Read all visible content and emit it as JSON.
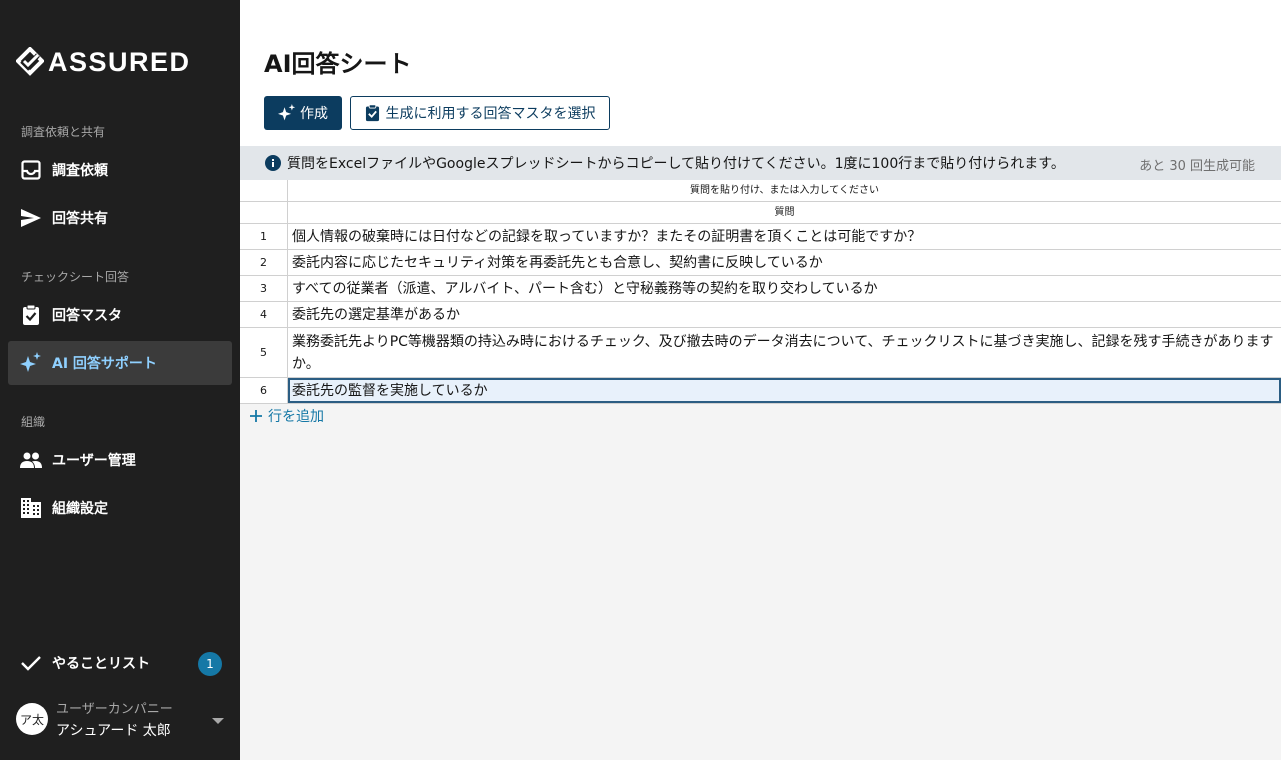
{
  "brand": {
    "name": "ASSURED"
  },
  "sidebar": {
    "sections": [
      {
        "label": "調査依頼と共有"
      },
      {
        "label": "チェックシート回答"
      },
      {
        "label": "組織"
      }
    ],
    "items": [
      {
        "label": "調査依頼",
        "icon": "inbox-icon"
      },
      {
        "label": "回答共有",
        "icon": "send-icon"
      },
      {
        "label": "回答マスタ",
        "icon": "clipboard-check-icon"
      },
      {
        "label": "AI 回答サポート",
        "icon": "sparkle-icon",
        "active": true
      },
      {
        "label": "ユーザー管理",
        "icon": "people-icon"
      },
      {
        "label": "組織設定",
        "icon": "building-icon"
      }
    ],
    "todo": {
      "label": "やることリスト",
      "count": "1"
    },
    "user": {
      "avatar": "ア太",
      "company": "ユーザーカンパニー",
      "name": "アシュアード 太郎"
    }
  },
  "main": {
    "title": "AI回答シート",
    "create_button": "作成",
    "select_master_button": "生成に利用する回答マスタを選択",
    "info": "質問をExcelファイルやGoogleスプレッドシートからコピーして貼り付けてください。1度に100行まで貼り付けられます。",
    "remaining": "あと 30 回生成可能",
    "table": {
      "instruction_header": "質問を貼り付け、または入力してください",
      "column_header": "質問",
      "rows": [
        {
          "num": "1",
          "text": "個人情報の破棄時には日付などの記録を取っていますか？またその証明書を頂くことは可能ですか？"
        },
        {
          "num": "2",
          "text": "委託内容に応じたセキュリティ対策を再委託先とも合意し、契約書に反映しているか"
        },
        {
          "num": "3",
          "text": "すべての従業者（派遣、アルバイト、パート含む）と守秘義務等の契約を取り交わしているか"
        },
        {
          "num": "4",
          "text": "委託先の選定基準があるか"
        },
        {
          "num": "5",
          "text": "業務委託先よりPC等機器類の持込み時におけるチェック、及び撤去時のデータ消去について、チェックリストに基づき実施し、記録を残す手続きがありますか。"
        },
        {
          "num": "6",
          "text": "委託先の監督を実施しているか"
        }
      ]
    },
    "add_row": "行を追加"
  },
  "colors": {
    "sidebar_bg": "#1f1f1f",
    "primary": "#0c3c5f",
    "accent": "#1578a6",
    "active_text": "#8fd0ff"
  }
}
